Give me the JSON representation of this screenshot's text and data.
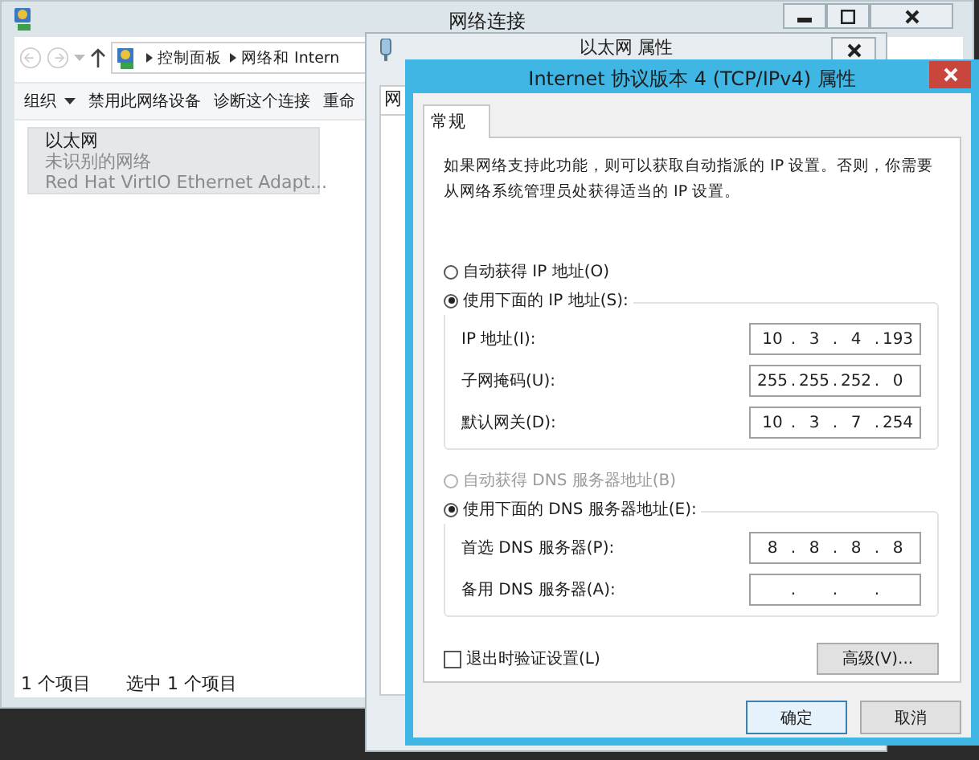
{
  "explorer": {
    "title": "网络连接",
    "breadcrumb": [
      "控制面板",
      "网络和 Intern"
    ],
    "toolbar": [
      {
        "label": "组织",
        "dropdown": true
      },
      {
        "label": "禁用此网络设备",
        "dropdown": false
      },
      {
        "label": "诊断这个连接",
        "dropdown": false
      },
      {
        "label": "重命",
        "dropdown": false
      }
    ],
    "items": [
      {
        "name": "以太网",
        "status": "未识别的网络",
        "adapter": "Red Hat VirtIO Ethernet Adapt...",
        "selected": true
      }
    ],
    "status_bar": [
      "1 个项目",
      "选中 1 个项目"
    ]
  },
  "properties": {
    "title": "以太网 属性",
    "tab": "网"
  },
  "dialog": {
    "title": "Internet 协议版本 4 (TCP/IPv4) 属性",
    "tabs": [
      {
        "label": "常规",
        "selected": true
      }
    ],
    "description": "如果网络支持此功能，则可以获取自动指派的 IP 设置。否则，你需要从网络系统管理员处获得适当的 IP 设置。",
    "separator": ".",
    "ip_mode": [
      {
        "label": "自动获得 IP 地址(O)",
        "selected": false,
        "disabled": false
      },
      {
        "label": "使用下面的 IP 地址(S):",
        "selected": true,
        "disabled": false
      }
    ],
    "ip_fields": [
      {
        "label": "IP 地址(I):",
        "octets": [
          "10",
          "3",
          "4",
          "193"
        ]
      },
      {
        "label": "子网掩码(U):",
        "octets": [
          "255",
          "255",
          "252",
          "0"
        ]
      },
      {
        "label": "默认网关(D):",
        "octets": [
          "10",
          "3",
          "7",
          "254"
        ]
      }
    ],
    "dns_mode": [
      {
        "label": "自动获得 DNS 服务器地址(B)",
        "selected": false,
        "disabled": true
      },
      {
        "label": "使用下面的 DNS 服务器地址(E):",
        "selected": true,
        "disabled": false
      }
    ],
    "dns_fields": [
      {
        "label": "首选 DNS 服务器(P):",
        "octets": [
          "8",
          "8",
          "8",
          "8"
        ]
      },
      {
        "label": "备用 DNS 服务器(A):"
      }
    ],
    "validate": {
      "label": "退出时验证设置(L)",
      "checked": false
    },
    "advanced": "高级(V)...",
    "buttons": [
      "确定",
      "取消"
    ]
  }
}
